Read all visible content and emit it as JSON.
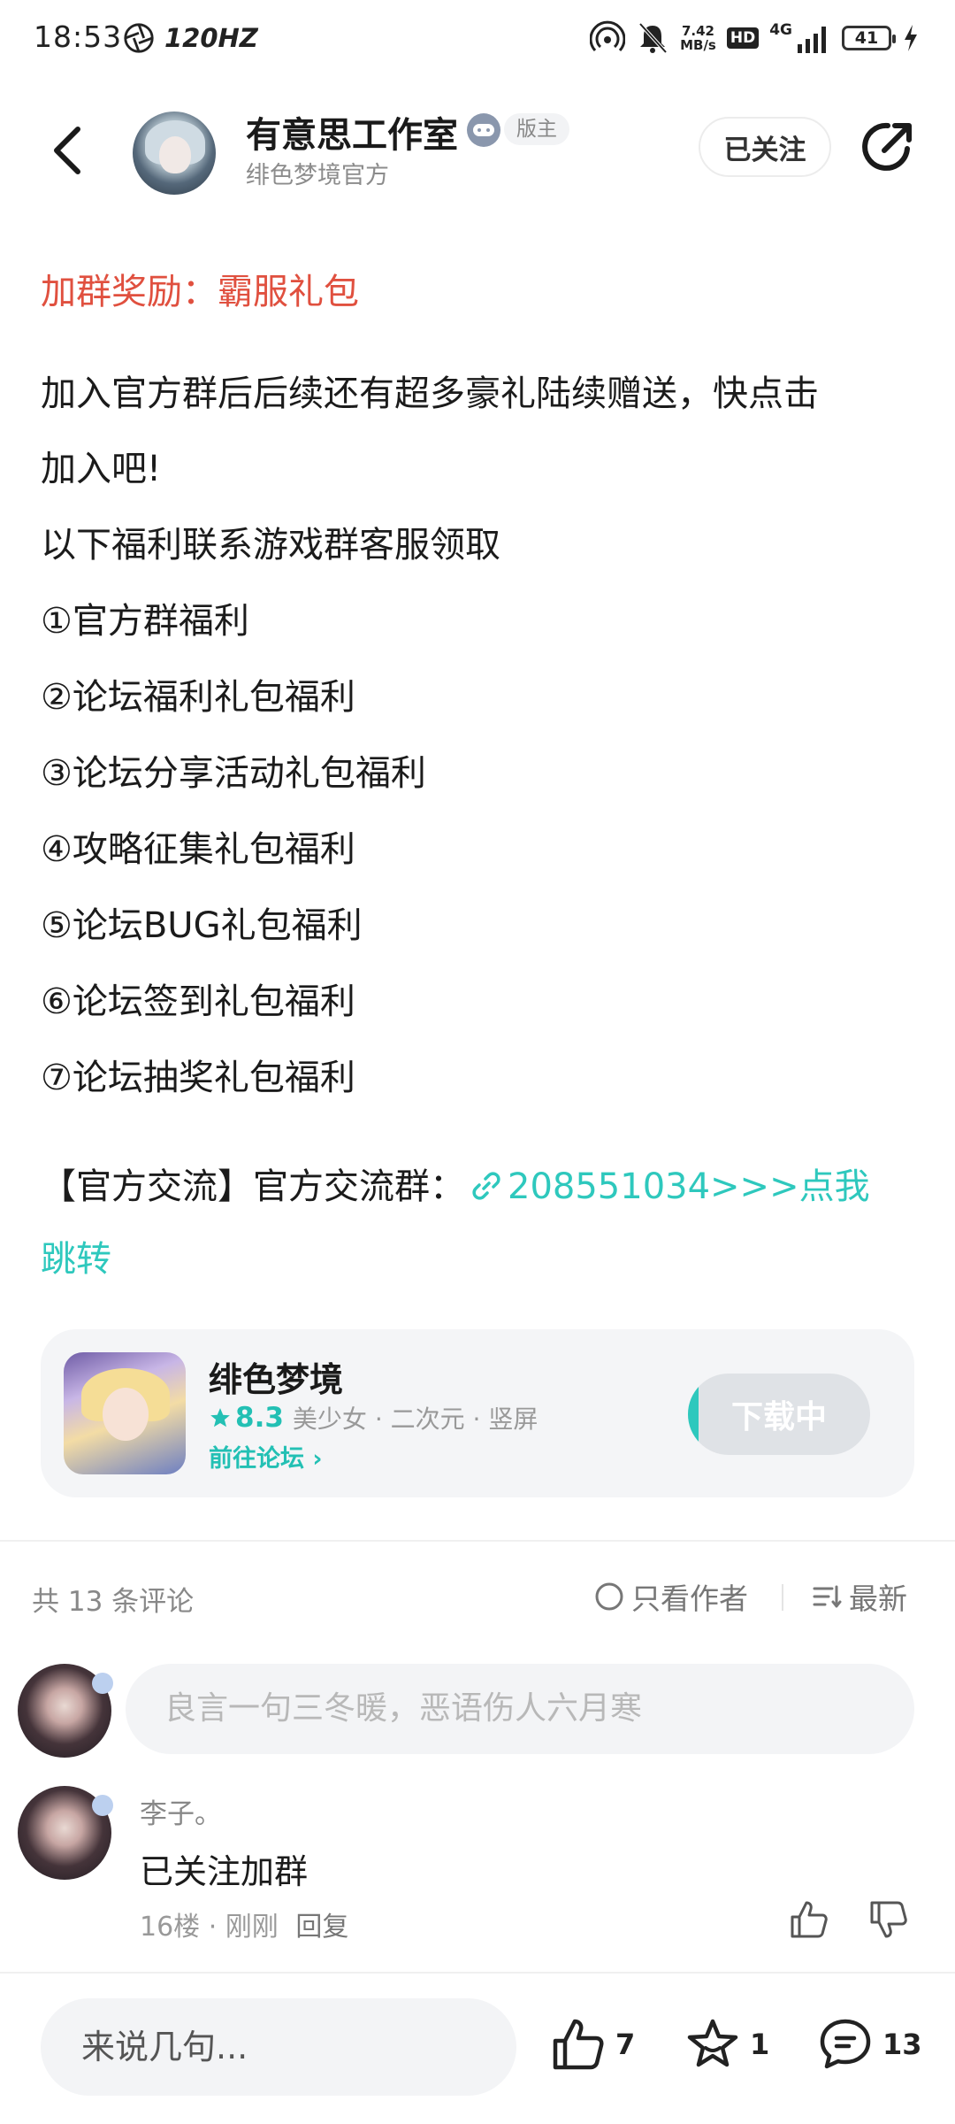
{
  "status_bar": {
    "time": "18:53",
    "refresh_rate": "120HZ",
    "net_speed_value": "7.42",
    "net_speed_unit": "MB/s",
    "hd_label": "HD",
    "network_label": "4G",
    "battery": "41"
  },
  "header": {
    "author_name": "有意思工作室",
    "role_badge": "版主",
    "author_subtitle": "绯色梦境官方",
    "follow_label": "已关注"
  },
  "post": {
    "reward_title": "加群奖励：霸服礼包",
    "intro_line1": "加入官方群后后续还有超多豪礼陆续赠送，快点击",
    "intro_line2": "加入吧!",
    "benefits": [
      "以下福利联系游戏群客服领取",
      "①官方群福利",
      "②论坛福利礼包福利",
      "③论坛分享活动礼包福利",
      "④攻略征集礼包福利",
      "⑤论坛BUG礼包福利",
      "⑥论坛签到礼包福利",
      "⑦论坛抽奖礼包福利"
    ],
    "group_prefix": "【官方交流】官方交流群：",
    "group_link_line1": "208551034>>>点我",
    "group_link_line2": "跳转"
  },
  "game_card": {
    "name": "绯色梦境",
    "rating": "8.3",
    "tags": "美少女 · 二次元 · 竖屏",
    "forum_link": "前往论坛 ›",
    "download_label": "下载中",
    "download_progress": 0.06
  },
  "comments": {
    "count_label": "共 13 条评论",
    "author_only_label": "只看作者",
    "sort_label": "最新",
    "input_placeholder": "良言一句三冬暖，恶语伤人六月寒",
    "items": [
      {
        "user": "李子。",
        "text": "已关注加群",
        "meta": "16楼 · 刚刚",
        "reply_label": "回复"
      }
    ]
  },
  "bottom_bar": {
    "input_placeholder": "来说几句...",
    "likes": "7",
    "favorites": "1",
    "comments": "13"
  }
}
